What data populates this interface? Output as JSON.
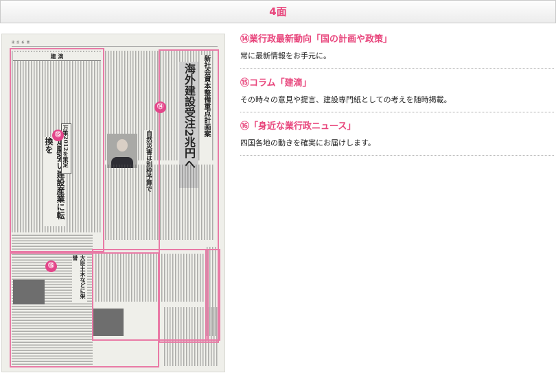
{
  "header": {
    "title": "4面"
  },
  "colors": {
    "accent": "#e8457c",
    "highlight": "#e97aa6"
  },
  "newspaper": {
    "masthead": "建 設 新 聞",
    "headline_main": "海外建設受注2兆円へ",
    "headline_sub": "新社会資本整備重点計画案",
    "headline_small": "自然災害は別枠予算で",
    "column_title": "建 滴",
    "column_head1": "足腰強い建設産業に転換を",
    "column_box": "万策2012を策定",
    "news_head": "大臣土木などに栄誉",
    "badges": [
      "⑭",
      "⑮",
      "⑯"
    ]
  },
  "items": [
    {
      "title": "⑭業行政最新動向「国の計画や政策」",
      "desc": "常に最新情報をお手元に。"
    },
    {
      "title": "⑮コラム「建滴」",
      "desc": "その時々の意見や提言、建設専門紙としての考えを随時掲載。"
    },
    {
      "title": "⑯「身近な業行政ニュース」",
      "desc": "四国各地の動きを確実にお届けします。"
    }
  ]
}
